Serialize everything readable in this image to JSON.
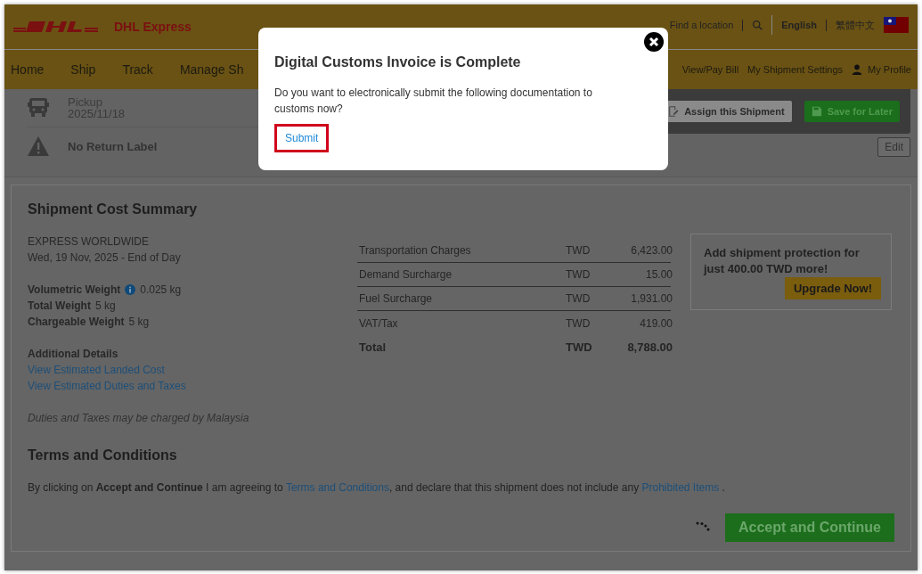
{
  "header": {
    "logo_text": "DHL Express",
    "links": [
      "Find a location"
    ],
    "languages": [
      {
        "label": "English",
        "selected": true
      },
      {
        "label": "繁體中文",
        "selected": false
      }
    ]
  },
  "nav": {
    "left": [
      "Home",
      "Ship",
      "Track",
      "Manage Sh"
    ],
    "right": [
      {
        "label": "View/Pay Bill",
        "kind": "link"
      },
      {
        "label": "My Shipment Settings",
        "kind": "link"
      },
      {
        "label": "My Profile",
        "kind": "profile"
      }
    ]
  },
  "shipment_info": [
    {
      "kind": "pickup",
      "title": "Pickup",
      "detail": "2025/11/18"
    },
    {
      "kind": "warning",
      "title": "No Return Label"
    }
  ],
  "actions": [
    {
      "label": "Assign this Shipment",
      "kind": "secondary"
    },
    {
      "label": "Save for Later",
      "kind": "primary"
    }
  ],
  "edit_button": "Edit",
  "summary": {
    "title": "Shipment Cost Summary",
    "service": "EXPRESS WORLDWIDE",
    "delivery": "Wed, 19 Nov, 2025 - End of Day",
    "weights": [
      {
        "label": "Volumetric Weight",
        "value": "0.025 kg",
        "info": true
      },
      {
        "label": "Total Weight",
        "value": "5 kg",
        "info": false
      },
      {
        "label": "Chargeable Weight",
        "value": "5 kg",
        "info": false
      }
    ],
    "additional_title": "Additional Details",
    "links": [
      "View Estimated Landed Cost",
      "View Estimated Duties and Taxes"
    ],
    "note": "Duties and Taxes may be charged by Malaysia"
  },
  "charges": {
    "rows": [
      {
        "label": "Transportation Charges",
        "currency": "TWD",
        "amount": "6,423.00"
      },
      {
        "label": "Demand Surcharge",
        "currency": "TWD",
        "amount": "15.00"
      },
      {
        "label": "Fuel Surcharge",
        "currency": "TWD",
        "amount": "1,931.00"
      },
      {
        "label": "VAT/Tax",
        "currency": "TWD",
        "amount": "419.00"
      }
    ],
    "total": {
      "label": "Total",
      "currency": "TWD",
      "amount": "8,788.00"
    }
  },
  "protection": {
    "text": "Add shipment protection for just 400.00 TWD more!",
    "button": "Upgrade Now!"
  },
  "terms": {
    "title": "Terms and Conditions",
    "parts": [
      {
        "kind": "text",
        "text": "By clicking on "
      },
      {
        "kind": "bold",
        "text": "Accept and Continue"
      },
      {
        "kind": "text",
        "text": " I am agreeing to "
      },
      {
        "kind": "link",
        "text": "Terms and Conditions"
      },
      {
        "kind": "text",
        "text": ", and declare that this shipment does not include any "
      },
      {
        "kind": "link",
        "text": "Prohibited Items"
      },
      {
        "kind": "text",
        "text": " ."
      }
    ]
  },
  "accept_button": {
    "label": "Accept and Continue",
    "loading": true
  },
  "modal": {
    "title": "Digital Customs Invoice is Complete",
    "message": "Do you want to electronically submit the following documentation to customs now?",
    "submit": "Submit",
    "submit_highlighted": true
  }
}
